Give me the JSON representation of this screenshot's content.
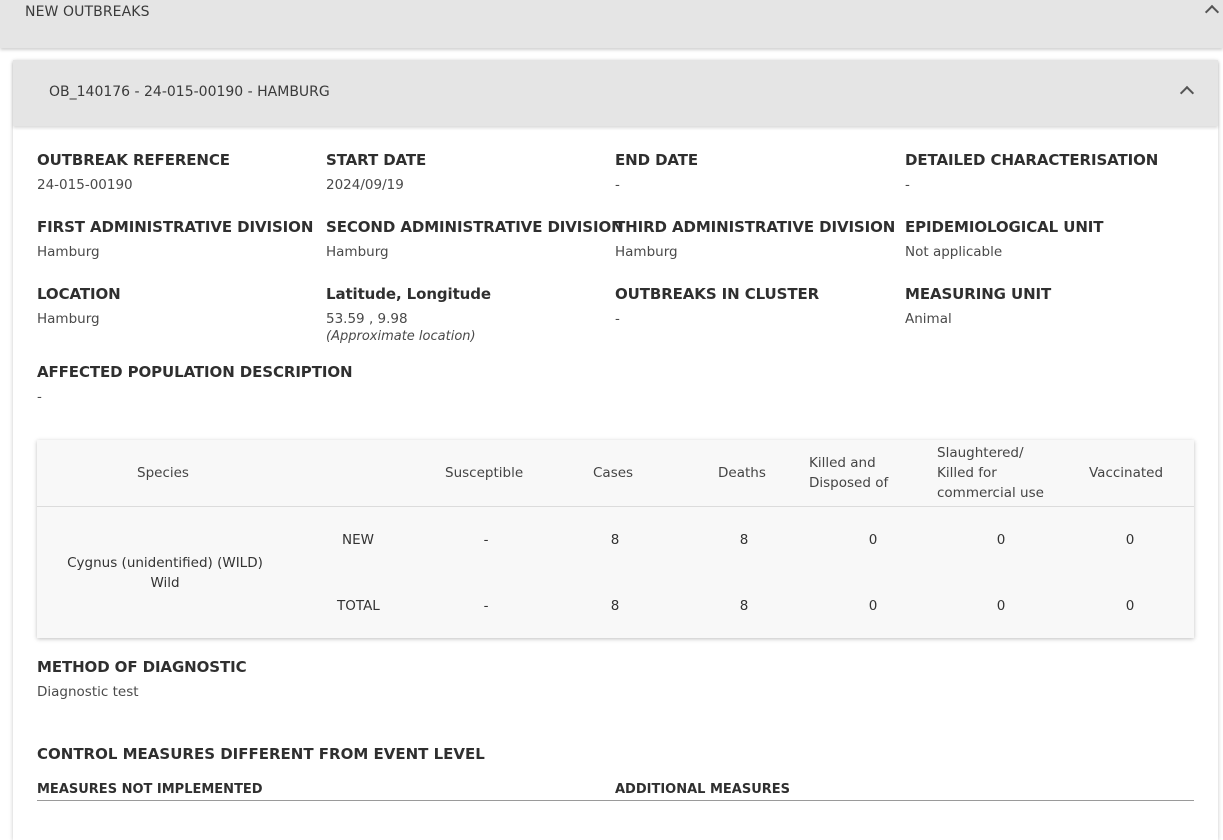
{
  "section": {
    "title": "NEW OUTBREAKS"
  },
  "outbreak": {
    "title": "OB_140176 - 24-015-00190 - HAMBURG"
  },
  "fields": {
    "reference": {
      "label": "OUTBREAK REFERENCE",
      "value": "24-015-00190"
    },
    "start_date": {
      "label": "START DATE",
      "value": "2024/09/19"
    },
    "end_date": {
      "label": "END DATE",
      "value": "-"
    },
    "characterisation": {
      "label": "DETAILED CHARACTERISATION",
      "value": "-"
    },
    "admin1": {
      "label": "FIRST ADMINISTRATIVE DIVISION",
      "value": "Hamburg"
    },
    "admin2": {
      "label": "SECOND ADMINISTRATIVE DIVISION",
      "value": "Hamburg"
    },
    "admin3": {
      "label": "THIRD ADMINISTRATIVE DIVISION",
      "value": "Hamburg"
    },
    "epi_unit": {
      "label": "EPIDEMIOLOGICAL UNIT",
      "value": "Not applicable"
    },
    "location": {
      "label": "LOCATION",
      "value": "Hamburg"
    },
    "latlon": {
      "label": "Latitude, Longitude",
      "value": "53.59 , 9.98",
      "note": "(Approximate location)"
    },
    "cluster": {
      "label": "OUTBREAKS IN CLUSTER",
      "value": "-"
    },
    "measuring_unit": {
      "label": "MEASURING UNIT",
      "value": "Animal"
    },
    "population": {
      "label": "AFFECTED POPULATION DESCRIPTION",
      "value": "-"
    }
  },
  "table": {
    "headers": {
      "species": "Species",
      "susceptible": "Susceptible",
      "cases": "Cases",
      "deaths": "Deaths",
      "killed_1": "Killed and",
      "killed_2": "Disposed of",
      "slaughtered_1": "Slaughtered/",
      "slaughtered_2": "Killed for",
      "slaughtered_3": "commercial use",
      "vaccinated": "Vaccinated"
    },
    "species_line1": "Cygnus (unidentified) (WILD)",
    "species_line2": "Wild",
    "rows": [
      {
        "label": "NEW",
        "susceptible": "-",
        "cases": "8",
        "deaths": "8",
        "killed": "0",
        "slaughtered": "0",
        "vaccinated": "0"
      },
      {
        "label": "TOTAL",
        "susceptible": "-",
        "cases": "8",
        "deaths": "8",
        "killed": "0",
        "slaughtered": "0",
        "vaccinated": "0"
      }
    ]
  },
  "diagnostic": {
    "label": "METHOD OF DIAGNOSTIC",
    "value": "Diagnostic test"
  },
  "control": {
    "title": "CONTROL MEASURES DIFFERENT FROM EVENT LEVEL",
    "not_implemented": "MEASURES NOT IMPLEMENTED",
    "additional": "ADDITIONAL MEASURES"
  }
}
